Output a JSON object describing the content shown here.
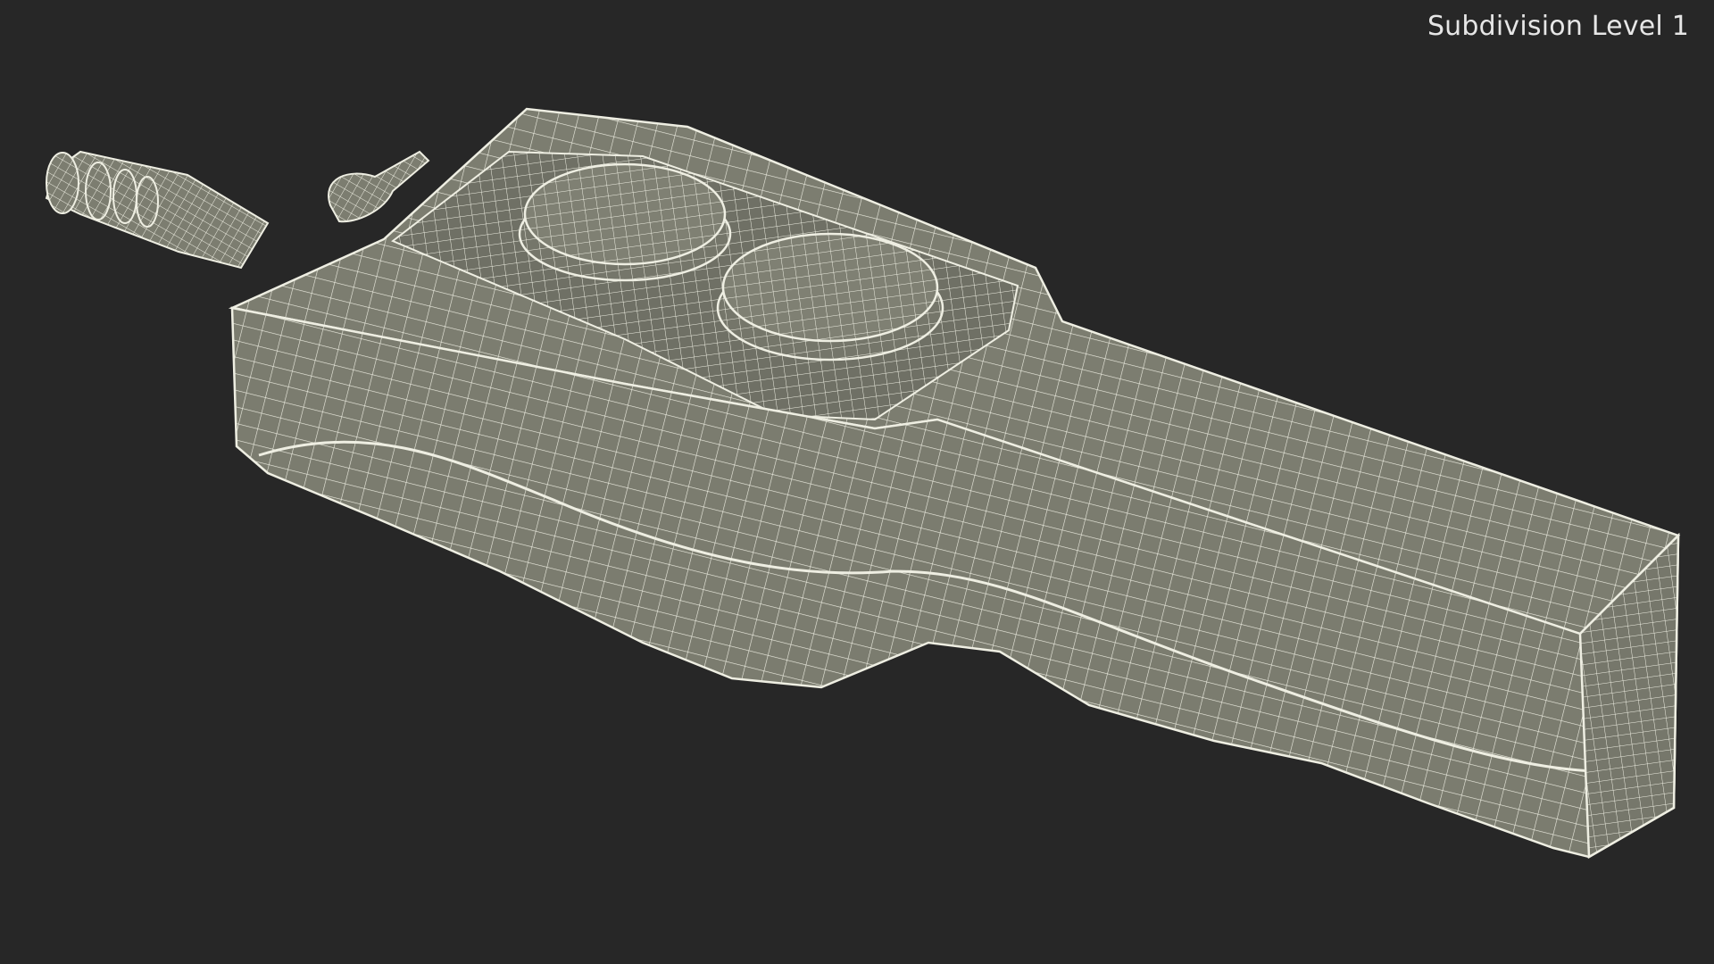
{
  "viewport": {
    "label": "Subdivision Level 1",
    "background_color": "#272727"
  },
  "model": {
    "surface_color": "#7c7d70",
    "wire_color": "#eeeee2"
  }
}
